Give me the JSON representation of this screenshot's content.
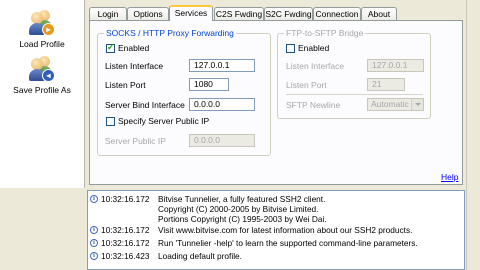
{
  "sidebar": {
    "load_profile": "Load Profile",
    "save_profile_as": "Save Profile As"
  },
  "tabs": [
    "Login",
    "Options",
    "Services",
    "C2S Fwding",
    "S2C Fwding",
    "Connection",
    "About"
  ],
  "active_tab": "Services",
  "socks": {
    "title": "SOCKS / HTTP Proxy Forwarding",
    "enabled_label": "Enabled",
    "enabled": true,
    "listen_interface_label": "Listen Interface",
    "listen_interface": "127.0.0.1",
    "listen_port_label": "Listen Port",
    "listen_port": "1080",
    "server_bind_label": "Server Bind Interface",
    "server_bind": "0.0.0.0",
    "specify_public_ip_label": "Specify Server Public IP",
    "specify_public_ip": false,
    "public_ip_label": "Server Public IP",
    "public_ip": "0.0.0.0"
  },
  "ftp": {
    "title": "FTP-to-SFTP Bridge",
    "enabled_label": "Enabled",
    "enabled": false,
    "listen_interface_label": "Listen Interface",
    "listen_interface": "127.0.0.1",
    "listen_port_label": "Listen Port",
    "listen_port": "21",
    "newline_label": "SFTP Newline",
    "newline": "Automatic"
  },
  "help": "Help",
  "log": [
    {
      "time": "10:32:16.172",
      "lines": [
        "Bitvise Tunnelier, a fully featured SSH2 client.",
        "Copyright (C) 2000-2005 by Bitvise Limited.",
        "Portions Copyright (C) 1995-2003 by Wei Dai."
      ]
    },
    {
      "time": "10:32:16.172",
      "lines": [
        "Visit www.bitvise.com for latest information about our SSH2 products."
      ]
    },
    {
      "time": "10:32:16.172",
      "lines": [
        "Run 'Tunnelier -help' to learn the supported command-line parameters."
      ]
    },
    {
      "time": "10:32:16.423",
      "lines": [
        "Loading default profile."
      ]
    }
  ]
}
